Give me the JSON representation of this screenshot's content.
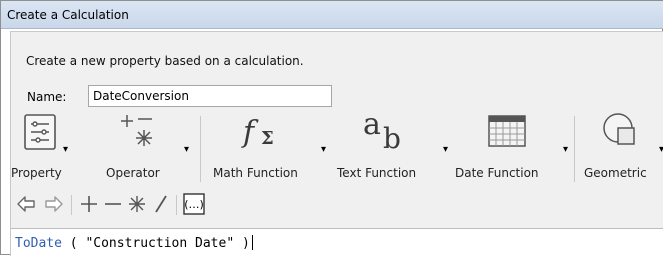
{
  "window": {
    "title": "Create a Calculation"
  },
  "dialog": {
    "description": "Create a new property based on a calculation.",
    "name_label": "Name:",
    "name_value": "DateConversion"
  },
  "ribbon": {
    "buttons": [
      {
        "label": "Property",
        "icon": "property-list-icon"
      },
      {
        "label": "Operator",
        "icon": "operator-icon"
      },
      {
        "label": "Math Function",
        "icon": "math-function-icon"
      },
      {
        "label": "Text Function",
        "icon": "text-function-icon"
      },
      {
        "label": "Date Function",
        "icon": "date-function-icon"
      },
      {
        "label": "Geometric",
        "icon": "geometric-icon"
      }
    ]
  },
  "edit_toolbar": {
    "tools": [
      "undo-icon",
      "redo-icon",
      "add-icon",
      "subtract-icon",
      "multiply-icon",
      "divide-icon",
      "parentheses-icon"
    ]
  },
  "expression": {
    "function": "ToDate",
    "args": " ( \"Construction Date\" )"
  },
  "colors": {
    "titlebar": "#c9d7ea",
    "keyword": "#2f5fb3",
    "panel": "#f0f0f0"
  }
}
